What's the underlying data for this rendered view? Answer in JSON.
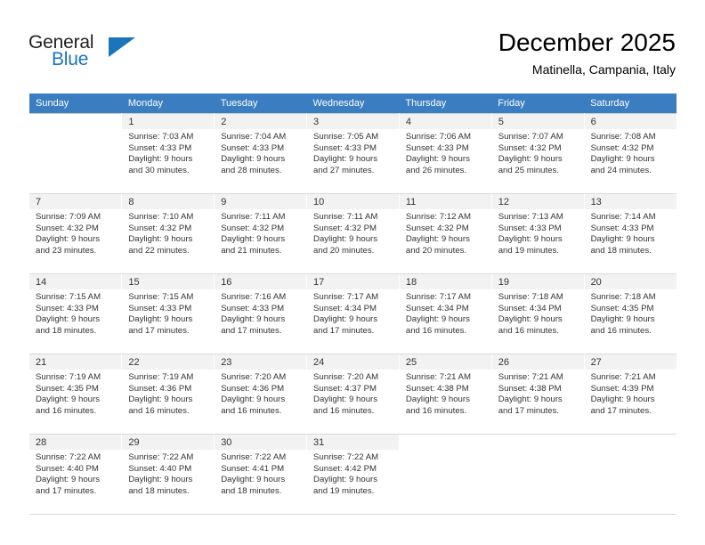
{
  "brand": {
    "name_top": "General",
    "name_bottom": "Blue",
    "accent_color": "#1b75bb"
  },
  "header": {
    "month_title": "December 2025",
    "location": "Matinella, Campania, Italy"
  },
  "calendar": {
    "header_background": "#3a7dc1",
    "daynum_background": "#f2f2f2",
    "weekday_headers": [
      "Sunday",
      "Monday",
      "Tuesday",
      "Wednesday",
      "Thursday",
      "Friday",
      "Saturday"
    ],
    "weeks": [
      [
        {
          "day": "",
          "sunrise": "",
          "sunset": "",
          "daylight1": "",
          "daylight2": "",
          "empty": true
        },
        {
          "day": "1",
          "sunrise": "Sunrise: 7:03 AM",
          "sunset": "Sunset: 4:33 PM",
          "daylight1": "Daylight: 9 hours",
          "daylight2": "and 30 minutes."
        },
        {
          "day": "2",
          "sunrise": "Sunrise: 7:04 AM",
          "sunset": "Sunset: 4:33 PM",
          "daylight1": "Daylight: 9 hours",
          "daylight2": "and 28 minutes."
        },
        {
          "day": "3",
          "sunrise": "Sunrise: 7:05 AM",
          "sunset": "Sunset: 4:33 PM",
          "daylight1": "Daylight: 9 hours",
          "daylight2": "and 27 minutes."
        },
        {
          "day": "4",
          "sunrise": "Sunrise: 7:06 AM",
          "sunset": "Sunset: 4:33 PM",
          "daylight1": "Daylight: 9 hours",
          "daylight2": "and 26 minutes."
        },
        {
          "day": "5",
          "sunrise": "Sunrise: 7:07 AM",
          "sunset": "Sunset: 4:32 PM",
          "daylight1": "Daylight: 9 hours",
          "daylight2": "and 25 minutes."
        },
        {
          "day": "6",
          "sunrise": "Sunrise: 7:08 AM",
          "sunset": "Sunset: 4:32 PM",
          "daylight1": "Daylight: 9 hours",
          "daylight2": "and 24 minutes."
        }
      ],
      [
        {
          "day": "7",
          "sunrise": "Sunrise: 7:09 AM",
          "sunset": "Sunset: 4:32 PM",
          "daylight1": "Daylight: 9 hours",
          "daylight2": "and 23 minutes."
        },
        {
          "day": "8",
          "sunrise": "Sunrise: 7:10 AM",
          "sunset": "Sunset: 4:32 PM",
          "daylight1": "Daylight: 9 hours",
          "daylight2": "and 22 minutes."
        },
        {
          "day": "9",
          "sunrise": "Sunrise: 7:11 AM",
          "sunset": "Sunset: 4:32 PM",
          "daylight1": "Daylight: 9 hours",
          "daylight2": "and 21 minutes."
        },
        {
          "day": "10",
          "sunrise": "Sunrise: 7:11 AM",
          "sunset": "Sunset: 4:32 PM",
          "daylight1": "Daylight: 9 hours",
          "daylight2": "and 20 minutes."
        },
        {
          "day": "11",
          "sunrise": "Sunrise: 7:12 AM",
          "sunset": "Sunset: 4:32 PM",
          "daylight1": "Daylight: 9 hours",
          "daylight2": "and 20 minutes."
        },
        {
          "day": "12",
          "sunrise": "Sunrise: 7:13 AM",
          "sunset": "Sunset: 4:33 PM",
          "daylight1": "Daylight: 9 hours",
          "daylight2": "and 19 minutes."
        },
        {
          "day": "13",
          "sunrise": "Sunrise: 7:14 AM",
          "sunset": "Sunset: 4:33 PM",
          "daylight1": "Daylight: 9 hours",
          "daylight2": "and 18 minutes."
        }
      ],
      [
        {
          "day": "14",
          "sunrise": "Sunrise: 7:15 AM",
          "sunset": "Sunset: 4:33 PM",
          "daylight1": "Daylight: 9 hours",
          "daylight2": "and 18 minutes."
        },
        {
          "day": "15",
          "sunrise": "Sunrise: 7:15 AM",
          "sunset": "Sunset: 4:33 PM",
          "daylight1": "Daylight: 9 hours",
          "daylight2": "and 17 minutes."
        },
        {
          "day": "16",
          "sunrise": "Sunrise: 7:16 AM",
          "sunset": "Sunset: 4:33 PM",
          "daylight1": "Daylight: 9 hours",
          "daylight2": "and 17 minutes."
        },
        {
          "day": "17",
          "sunrise": "Sunrise: 7:17 AM",
          "sunset": "Sunset: 4:34 PM",
          "daylight1": "Daylight: 9 hours",
          "daylight2": "and 17 minutes."
        },
        {
          "day": "18",
          "sunrise": "Sunrise: 7:17 AM",
          "sunset": "Sunset: 4:34 PM",
          "daylight1": "Daylight: 9 hours",
          "daylight2": "and 16 minutes."
        },
        {
          "day": "19",
          "sunrise": "Sunrise: 7:18 AM",
          "sunset": "Sunset: 4:34 PM",
          "daylight1": "Daylight: 9 hours",
          "daylight2": "and 16 minutes."
        },
        {
          "day": "20",
          "sunrise": "Sunrise: 7:18 AM",
          "sunset": "Sunset: 4:35 PM",
          "daylight1": "Daylight: 9 hours",
          "daylight2": "and 16 minutes."
        }
      ],
      [
        {
          "day": "21",
          "sunrise": "Sunrise: 7:19 AM",
          "sunset": "Sunset: 4:35 PM",
          "daylight1": "Daylight: 9 hours",
          "daylight2": "and 16 minutes."
        },
        {
          "day": "22",
          "sunrise": "Sunrise: 7:19 AM",
          "sunset": "Sunset: 4:36 PM",
          "daylight1": "Daylight: 9 hours",
          "daylight2": "and 16 minutes."
        },
        {
          "day": "23",
          "sunrise": "Sunrise: 7:20 AM",
          "sunset": "Sunset: 4:36 PM",
          "daylight1": "Daylight: 9 hours",
          "daylight2": "and 16 minutes."
        },
        {
          "day": "24",
          "sunrise": "Sunrise: 7:20 AM",
          "sunset": "Sunset: 4:37 PM",
          "daylight1": "Daylight: 9 hours",
          "daylight2": "and 16 minutes."
        },
        {
          "day": "25",
          "sunrise": "Sunrise: 7:21 AM",
          "sunset": "Sunset: 4:38 PM",
          "daylight1": "Daylight: 9 hours",
          "daylight2": "and 16 minutes."
        },
        {
          "day": "26",
          "sunrise": "Sunrise: 7:21 AM",
          "sunset": "Sunset: 4:38 PM",
          "daylight1": "Daylight: 9 hours",
          "daylight2": "and 17 minutes."
        },
        {
          "day": "27",
          "sunrise": "Sunrise: 7:21 AM",
          "sunset": "Sunset: 4:39 PM",
          "daylight1": "Daylight: 9 hours",
          "daylight2": "and 17 minutes."
        }
      ],
      [
        {
          "day": "28",
          "sunrise": "Sunrise: 7:22 AM",
          "sunset": "Sunset: 4:40 PM",
          "daylight1": "Daylight: 9 hours",
          "daylight2": "and 17 minutes."
        },
        {
          "day": "29",
          "sunrise": "Sunrise: 7:22 AM",
          "sunset": "Sunset: 4:40 PM",
          "daylight1": "Daylight: 9 hours",
          "daylight2": "and 18 minutes."
        },
        {
          "day": "30",
          "sunrise": "Sunrise: 7:22 AM",
          "sunset": "Sunset: 4:41 PM",
          "daylight1": "Daylight: 9 hours",
          "daylight2": "and 18 minutes."
        },
        {
          "day": "31",
          "sunrise": "Sunrise: 7:22 AM",
          "sunset": "Sunset: 4:42 PM",
          "daylight1": "Daylight: 9 hours",
          "daylight2": "and 19 minutes."
        },
        {
          "day": "",
          "sunrise": "",
          "sunset": "",
          "daylight1": "",
          "daylight2": "",
          "empty": true
        },
        {
          "day": "",
          "sunrise": "",
          "sunset": "",
          "daylight1": "",
          "daylight2": "",
          "empty": true
        },
        {
          "day": "",
          "sunrise": "",
          "sunset": "",
          "daylight1": "",
          "daylight2": "",
          "empty": true
        }
      ]
    ]
  }
}
